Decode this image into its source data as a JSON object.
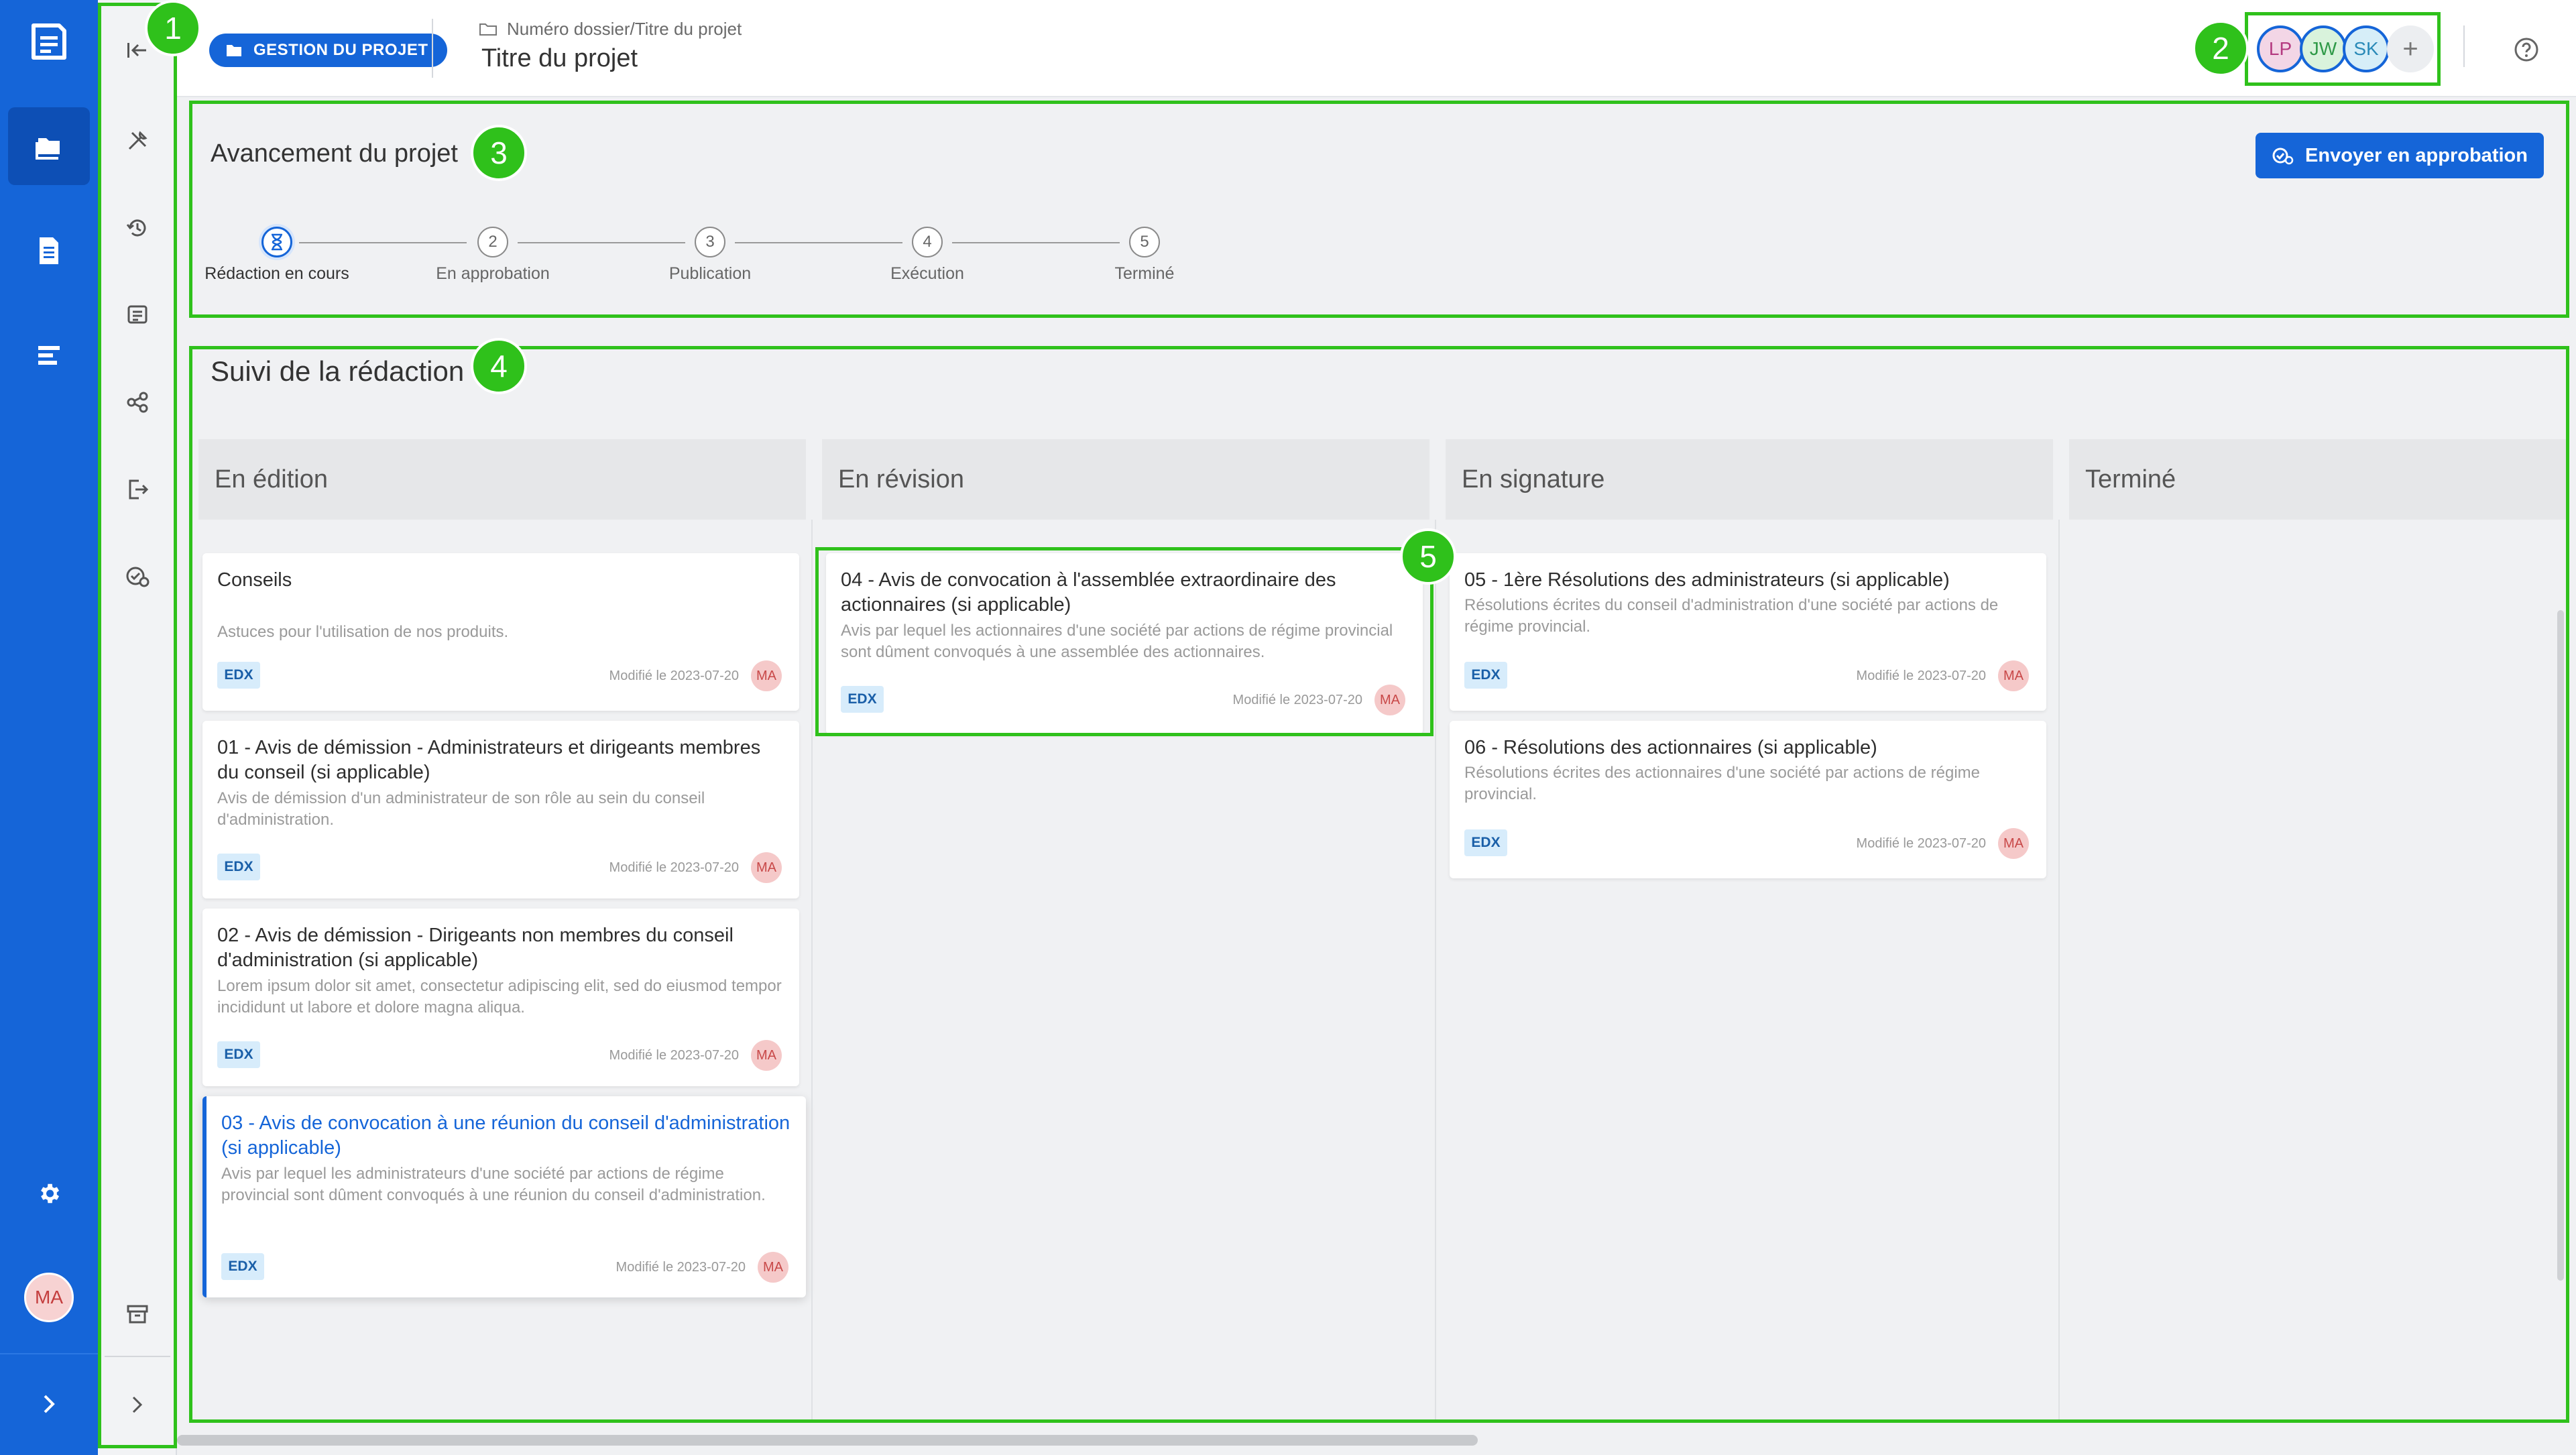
{
  "header": {
    "badge_label": "GESTION DU PROJET",
    "breadcrumb": "Numéro dossier/Titre du projet",
    "title": "Titre du projet",
    "collaborators": [
      {
        "initials": "LP",
        "bg": "#f3d6e6",
        "color": "#b43a80"
      },
      {
        "initials": "JW",
        "bg": "#d9f3dc",
        "color": "#2f9a48"
      },
      {
        "initials": "SK",
        "bg": "#d6eef8",
        "color": "#2a8ab8"
      }
    ],
    "add_symbol": "+"
  },
  "progress": {
    "title": "Avancement du projet",
    "send_button": "Envoyer en approbation",
    "steps": [
      {
        "number": "",
        "label": "Rédaction en cours",
        "current": true
      },
      {
        "number": "2",
        "label": "En approbation"
      },
      {
        "number": "3",
        "label": "Publication"
      },
      {
        "number": "4",
        "label": "Exécution"
      },
      {
        "number": "5",
        "label": "Terminé"
      }
    ]
  },
  "tracking": {
    "title": "Suivi de la rédaction",
    "columns": [
      {
        "title": "En édition",
        "cards": [
          {
            "title": "Conseils",
            "desc": "Astuces pour l'utilisation de nos produits.",
            "tag": "EDX",
            "modified": "Modifié le 2023-07-20",
            "author": "MA"
          },
          {
            "title": "01 - Avis de démission - Administrateurs et dirigeants membres du conseil (si applicable)",
            "desc": "Avis  de démission d'un administrateur de son rôle au sein du conseil d'administration.",
            "tag": "EDX",
            "modified": "Modifié le 2023-07-20",
            "author": "MA"
          },
          {
            "title": "02 - Avis de démission - Dirigeants non membres du conseil d'administration (si applicable)",
            "desc": "Lorem ipsum dolor sit amet, consectetur adipiscing elit, sed do eiusmod tempor incididunt ut labore et dolore magna aliqua.",
            "tag": "EDX",
            "modified": "Modifié le 2023-07-20",
            "author": "MA"
          },
          {
            "title": "03 - Avis de convocation à une réunion du conseil d'administration (si applicable)",
            "desc": "Avis par lequel les administrateurs d'une société par actions de régime provincial sont dûment convoqués à une réunion du conseil d'administration.",
            "tag": "EDX",
            "modified": "Modifié le 2023-07-20",
            "author": "MA"
          }
        ]
      },
      {
        "title": "En révision",
        "cards": [
          {
            "title": "04 - Avis de convocation à l'assemblée extraordinaire des actionnaires (si applicable)",
            "desc": "Avis par lequel les actionnaires d'une société par actions de régime provincial sont dûment convoqués à  une assemblée des actionnaires.",
            "tag": "EDX",
            "modified": "Modifié le 2023-07-20",
            "author": "MA"
          }
        ]
      },
      {
        "title": "En signature",
        "cards": [
          {
            "title": "05 - 1ère Résolutions des administrateurs (si applicable)",
            "desc": "Résolutions écrites du conseil d'administration d'une société par actions de régime provincial.",
            "tag": "EDX",
            "modified": "Modifié le 2023-07-20",
            "author": "MA"
          },
          {
            "title": "06 - Résolutions des actionnaires (si applicable)",
            "desc": "Résolutions écrites des actionnaires d'une société par actions de régime provincial.",
            "tag": "EDX",
            "modified": "Modifié le 2023-07-20",
            "author": "MA"
          }
        ]
      },
      {
        "title": "Terminé",
        "cards": []
      }
    ]
  },
  "user": {
    "initials": "MA"
  },
  "annotations": [
    "1",
    "2",
    "3",
    "4",
    "5"
  ],
  "colors": {
    "brand": "#1565d8",
    "annotation": "#2fc11b",
    "active_card": "#1565d8"
  }
}
